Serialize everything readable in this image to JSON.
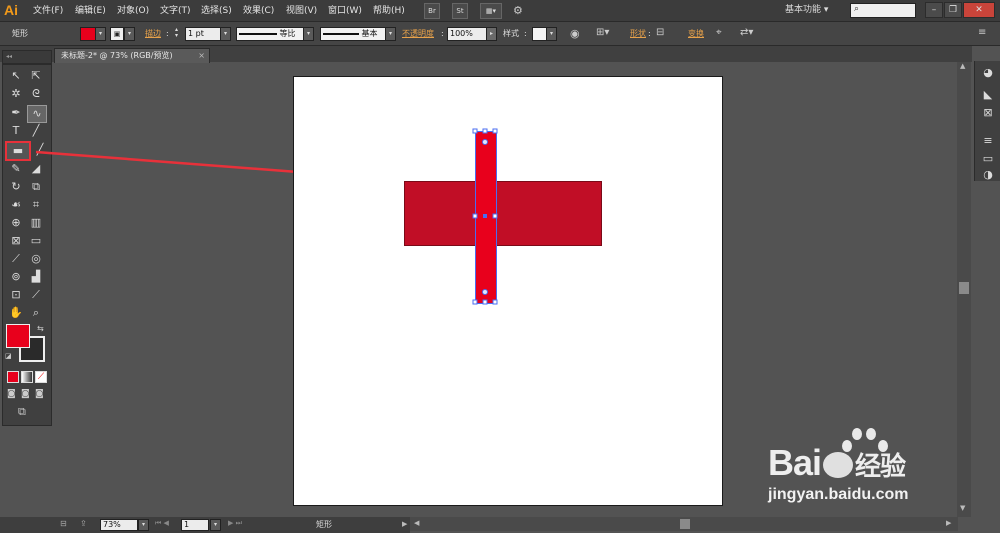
{
  "app": {
    "logo": "Ai"
  },
  "menu": [
    "文件(F)",
    "编辑(E)",
    "对象(O)",
    "文字(T)",
    "选择(S)",
    "效果(C)",
    "视图(V)",
    "窗口(W)",
    "帮助(H)"
  ],
  "menubar_buttons": {
    "br": "Br",
    "st": "St"
  },
  "workspace": "基本功能",
  "window_buttons": {
    "min": "–",
    "restore": "❐",
    "close": "✕"
  },
  "control": {
    "object_label": "矩形",
    "stroke_label": "描边",
    "stroke_weight": "1 pt",
    "stroke_profile": "等比",
    "brush": "基本",
    "opacity_label": "不透明度",
    "opacity_value": "100%",
    "style_label": "样式",
    "shape_label": "形状",
    "transform_label": "变换"
  },
  "doc_tab": "未标题-2* @ 73% (RGB/预览)",
  "colors": {
    "fill": "#e8001c",
    "rect_color": "#c10e26",
    "selection": "#4a6cf0",
    "arrow": "#e8313a"
  },
  "status": {
    "zoom": "73%",
    "page": "1",
    "tool_name": "矩形"
  },
  "watermark": {
    "brand_text": "Bai",
    "brand_text2": "经验",
    "url": "jingyan.baidu.com"
  }
}
